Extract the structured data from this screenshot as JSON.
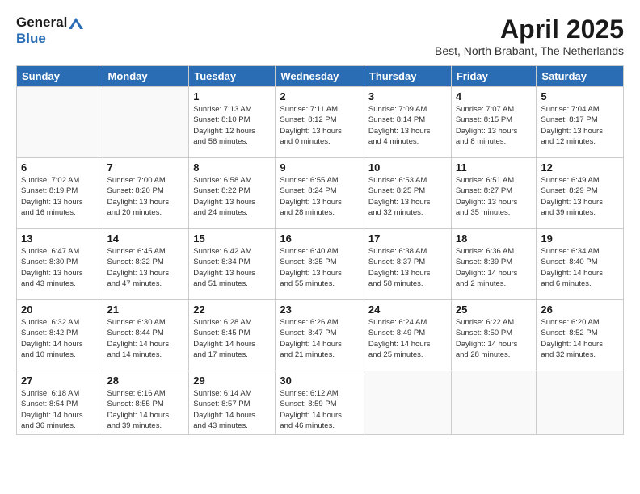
{
  "header": {
    "logo_line1": "General",
    "logo_line2": "Blue",
    "title": "April 2025",
    "subtitle": "Best, North Brabant, The Netherlands"
  },
  "weekdays": [
    "Sunday",
    "Monday",
    "Tuesday",
    "Wednesday",
    "Thursday",
    "Friday",
    "Saturday"
  ],
  "weeks": [
    [
      {
        "num": "",
        "info": ""
      },
      {
        "num": "",
        "info": ""
      },
      {
        "num": "1",
        "info": "Sunrise: 7:13 AM\nSunset: 8:10 PM\nDaylight: 12 hours\nand 56 minutes."
      },
      {
        "num": "2",
        "info": "Sunrise: 7:11 AM\nSunset: 8:12 PM\nDaylight: 13 hours\nand 0 minutes."
      },
      {
        "num": "3",
        "info": "Sunrise: 7:09 AM\nSunset: 8:14 PM\nDaylight: 13 hours\nand 4 minutes."
      },
      {
        "num": "4",
        "info": "Sunrise: 7:07 AM\nSunset: 8:15 PM\nDaylight: 13 hours\nand 8 minutes."
      },
      {
        "num": "5",
        "info": "Sunrise: 7:04 AM\nSunset: 8:17 PM\nDaylight: 13 hours\nand 12 minutes."
      }
    ],
    [
      {
        "num": "6",
        "info": "Sunrise: 7:02 AM\nSunset: 8:19 PM\nDaylight: 13 hours\nand 16 minutes."
      },
      {
        "num": "7",
        "info": "Sunrise: 7:00 AM\nSunset: 8:20 PM\nDaylight: 13 hours\nand 20 minutes."
      },
      {
        "num": "8",
        "info": "Sunrise: 6:58 AM\nSunset: 8:22 PM\nDaylight: 13 hours\nand 24 minutes."
      },
      {
        "num": "9",
        "info": "Sunrise: 6:55 AM\nSunset: 8:24 PM\nDaylight: 13 hours\nand 28 minutes."
      },
      {
        "num": "10",
        "info": "Sunrise: 6:53 AM\nSunset: 8:25 PM\nDaylight: 13 hours\nand 32 minutes."
      },
      {
        "num": "11",
        "info": "Sunrise: 6:51 AM\nSunset: 8:27 PM\nDaylight: 13 hours\nand 35 minutes."
      },
      {
        "num": "12",
        "info": "Sunrise: 6:49 AM\nSunset: 8:29 PM\nDaylight: 13 hours\nand 39 minutes."
      }
    ],
    [
      {
        "num": "13",
        "info": "Sunrise: 6:47 AM\nSunset: 8:30 PM\nDaylight: 13 hours\nand 43 minutes."
      },
      {
        "num": "14",
        "info": "Sunrise: 6:45 AM\nSunset: 8:32 PM\nDaylight: 13 hours\nand 47 minutes."
      },
      {
        "num": "15",
        "info": "Sunrise: 6:42 AM\nSunset: 8:34 PM\nDaylight: 13 hours\nand 51 minutes."
      },
      {
        "num": "16",
        "info": "Sunrise: 6:40 AM\nSunset: 8:35 PM\nDaylight: 13 hours\nand 55 minutes."
      },
      {
        "num": "17",
        "info": "Sunrise: 6:38 AM\nSunset: 8:37 PM\nDaylight: 13 hours\nand 58 minutes."
      },
      {
        "num": "18",
        "info": "Sunrise: 6:36 AM\nSunset: 8:39 PM\nDaylight: 14 hours\nand 2 minutes."
      },
      {
        "num": "19",
        "info": "Sunrise: 6:34 AM\nSunset: 8:40 PM\nDaylight: 14 hours\nand 6 minutes."
      }
    ],
    [
      {
        "num": "20",
        "info": "Sunrise: 6:32 AM\nSunset: 8:42 PM\nDaylight: 14 hours\nand 10 minutes."
      },
      {
        "num": "21",
        "info": "Sunrise: 6:30 AM\nSunset: 8:44 PM\nDaylight: 14 hours\nand 14 minutes."
      },
      {
        "num": "22",
        "info": "Sunrise: 6:28 AM\nSunset: 8:45 PM\nDaylight: 14 hours\nand 17 minutes."
      },
      {
        "num": "23",
        "info": "Sunrise: 6:26 AM\nSunset: 8:47 PM\nDaylight: 14 hours\nand 21 minutes."
      },
      {
        "num": "24",
        "info": "Sunrise: 6:24 AM\nSunset: 8:49 PM\nDaylight: 14 hours\nand 25 minutes."
      },
      {
        "num": "25",
        "info": "Sunrise: 6:22 AM\nSunset: 8:50 PM\nDaylight: 14 hours\nand 28 minutes."
      },
      {
        "num": "26",
        "info": "Sunrise: 6:20 AM\nSunset: 8:52 PM\nDaylight: 14 hours\nand 32 minutes."
      }
    ],
    [
      {
        "num": "27",
        "info": "Sunrise: 6:18 AM\nSunset: 8:54 PM\nDaylight: 14 hours\nand 36 minutes."
      },
      {
        "num": "28",
        "info": "Sunrise: 6:16 AM\nSunset: 8:55 PM\nDaylight: 14 hours\nand 39 minutes."
      },
      {
        "num": "29",
        "info": "Sunrise: 6:14 AM\nSunset: 8:57 PM\nDaylight: 14 hours\nand 43 minutes."
      },
      {
        "num": "30",
        "info": "Sunrise: 6:12 AM\nSunset: 8:59 PM\nDaylight: 14 hours\nand 46 minutes."
      },
      {
        "num": "",
        "info": ""
      },
      {
        "num": "",
        "info": ""
      },
      {
        "num": "",
        "info": ""
      }
    ]
  ]
}
